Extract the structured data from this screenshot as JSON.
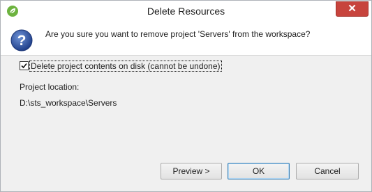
{
  "window": {
    "title": "Delete Resources",
    "close_label": "✕"
  },
  "message": {
    "text": "Are you sure you want to remove project 'Servers' from the workspace?"
  },
  "options": {
    "delete_contents_label": "Delete project contents on disk (cannot be undone)",
    "delete_contents_checked": true
  },
  "location": {
    "label": "Project location:",
    "value": "D:\\sts_workspace\\Servers"
  },
  "buttons": {
    "preview_label": "Preview >",
    "ok_label": "OK",
    "cancel_label": "Cancel"
  },
  "colors": {
    "close_button": "#c7443d",
    "question_icon": "#2b53a3",
    "app_icon": "#6db33f"
  },
  "icons": {
    "app": "spring-leaf-icon",
    "message": "question-icon",
    "close": "close-icon",
    "checkbox": "checkmark-icon"
  }
}
